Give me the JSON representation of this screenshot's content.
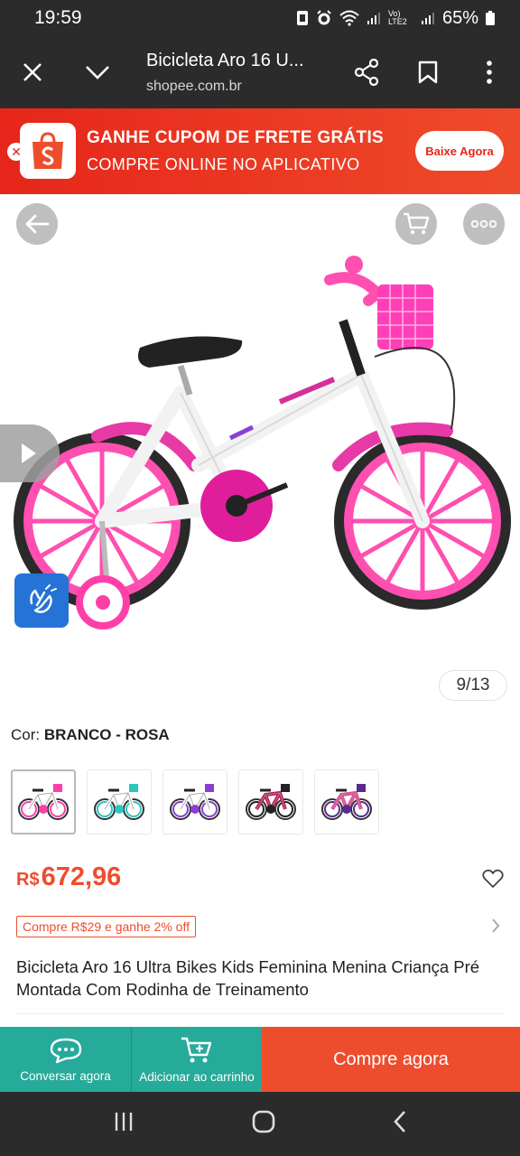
{
  "status_bar": {
    "time": "19:59",
    "network": "Vo) LTE2",
    "battery": "65%"
  },
  "browser": {
    "title": "Bicicleta Aro 16 U...",
    "url": "shopee.com.br",
    "icons": [
      "close-icon",
      "chevron-down-icon",
      "share-icon",
      "bookmark-icon",
      "more-vertical-icon"
    ]
  },
  "promo": {
    "line1": "GANHE CUPOM DE FRETE GRÁTIS",
    "line2": "COMPRE ONLINE NO APLICATIVO",
    "button": "Baixe Agora",
    "accent": "#e6261a"
  },
  "gallery": {
    "counter": "9/13",
    "current": 9,
    "total": 13
  },
  "variant": {
    "label": "Cor:",
    "value": "BRANCO - ROSA",
    "options": [
      {
        "frame": "#ffffff",
        "accent": "#ff3fa8"
      },
      {
        "frame": "#ffffff",
        "accent": "#2cc7c0"
      },
      {
        "frame": "#ffffff",
        "accent": "#8a3fd1"
      },
      {
        "frame": "#c01a5a",
        "accent": "#222222"
      },
      {
        "frame": "#e84a9a",
        "accent": "#5b2a8e"
      }
    ]
  },
  "price": {
    "currency": "R$",
    "value": "672,96"
  },
  "coupon": "Compre R$29 e ganhe 2% off",
  "product_title": "Bicicleta Aro 16 Ultra Bikes Kids Feminina Menina Criança Pré Montada Com Rodinha de Treinamento",
  "actions": {
    "chat": "Conversar agora",
    "cart": "Adicionar ao carrinho",
    "buy": "Compre agora"
  },
  "colors": {
    "brand": "#ee4d2d",
    "teal": "#26aa99"
  }
}
